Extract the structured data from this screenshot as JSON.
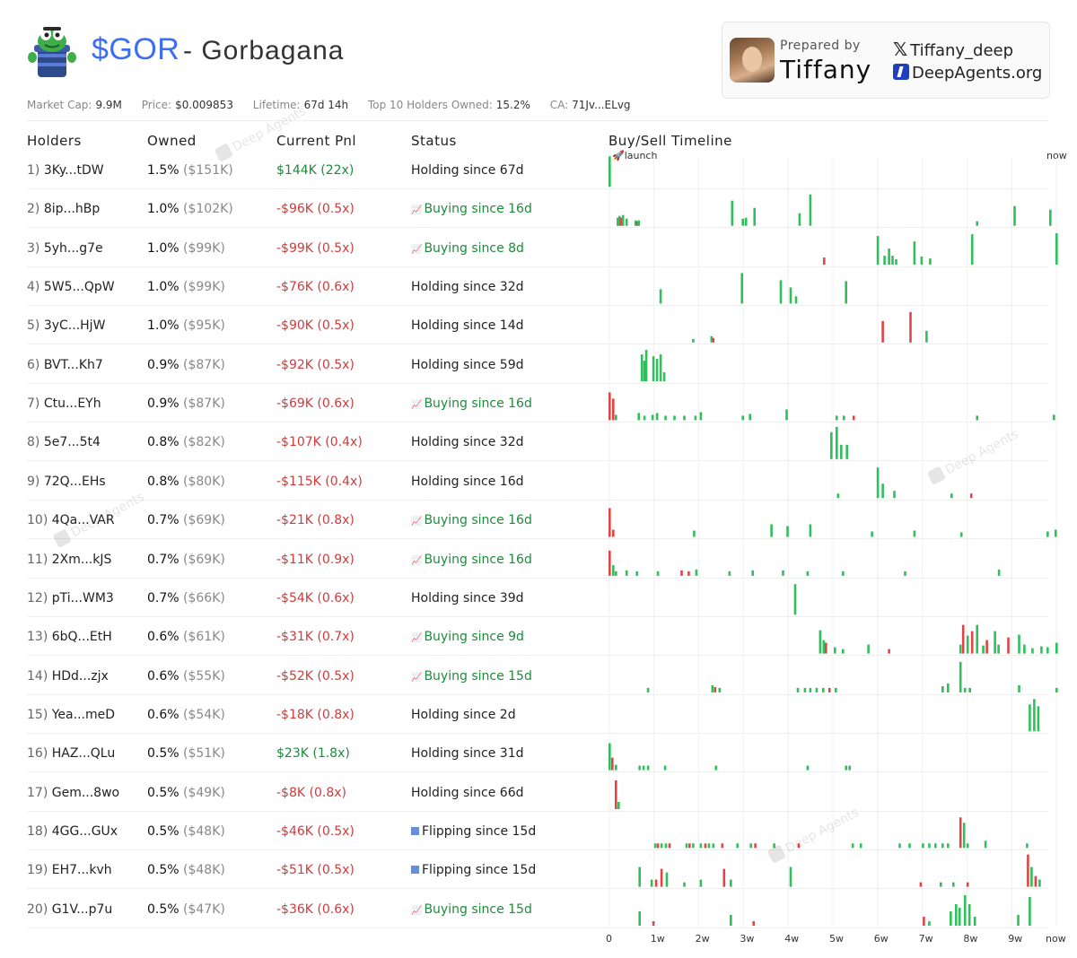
{
  "token": {
    "ticker": "$GOR",
    "name_sep": " - Gorbagana"
  },
  "prepared": {
    "label": "Prepared by",
    "name": "Tiffany",
    "x_handle": "Tiffany_deep",
    "site": "DeepAgents.org"
  },
  "stats": [
    {
      "label": "Market Cap:",
      "value": "9.9M"
    },
    {
      "label": "Price:",
      "value": "$0.009853"
    },
    {
      "label": "Lifetime:",
      "value": "67d 14h"
    },
    {
      "label": "Top 10 Holders Owned:",
      "value": "15.2%"
    },
    {
      "label": "CA:",
      "value": "71Jv...ELvg"
    }
  ],
  "columns": {
    "holders": "Holders",
    "owned": "Owned",
    "pnl": "Current Pnl",
    "status": "Status",
    "timeline": "Buy/Sell Timeline"
  },
  "timeline_axis": {
    "start_label": "🚀launch",
    "end_label": "now",
    "ticks": [
      "0",
      "1w",
      "2w",
      "3w",
      "4w",
      "5w",
      "6w",
      "7w",
      "8w",
      "9w",
      "now"
    ]
  },
  "watermark": "Deep Agents",
  "colors": {
    "buy": "#2fbf5b",
    "sell": "#e04545",
    "accent": "#3b6ef5"
  },
  "holders": [
    {
      "rank": "1)",
      "addr": "3Ky...tDW",
      "pct": "1.5%",
      "usd": "($151K)",
      "pnl": "$144K (22x)",
      "pnl_sign": "pos",
      "status": "Holding since 67d",
      "kind": "hold"
    },
    {
      "rank": "2)",
      "addr": "8ip...hBp",
      "pct": "1.0%",
      "usd": "($102K)",
      "pnl": "-$96K (0.5x)",
      "pnl_sign": "neg",
      "status": "Buying since 16d",
      "kind": "buy"
    },
    {
      "rank": "3)",
      "addr": "5yh...g7e",
      "pct": "1.0%",
      "usd": "($99K)",
      "pnl": "-$99K (0.5x)",
      "pnl_sign": "neg",
      "status": "Buying since 8d",
      "kind": "buy"
    },
    {
      "rank": "4)",
      "addr": "5W5...QpW",
      "pct": "1.0%",
      "usd": "($99K)",
      "pnl": "-$76K (0.6x)",
      "pnl_sign": "neg",
      "status": "Holding since 32d",
      "kind": "hold"
    },
    {
      "rank": "5)",
      "addr": "3yC...HjW",
      "pct": "1.0%",
      "usd": "($95K)",
      "pnl": "-$90K (0.5x)",
      "pnl_sign": "neg",
      "status": "Holding since 14d",
      "kind": "hold"
    },
    {
      "rank": "6)",
      "addr": "BVT...Kh7",
      "pct": "0.9%",
      "usd": "($87K)",
      "pnl": "-$92K (0.5x)",
      "pnl_sign": "neg",
      "status": "Holding since 59d",
      "kind": "hold"
    },
    {
      "rank": "7)",
      "addr": "Ctu...EYh",
      "pct": "0.9%",
      "usd": "($87K)",
      "pnl": "-$69K (0.6x)",
      "pnl_sign": "neg",
      "status": "Buying since 16d",
      "kind": "buy"
    },
    {
      "rank": "8)",
      "addr": "5e7...5t4",
      "pct": "0.8%",
      "usd": "($82K)",
      "pnl": "-$107K (0.4x)",
      "pnl_sign": "neg",
      "status": "Holding since 32d",
      "kind": "hold"
    },
    {
      "rank": "9)",
      "addr": "72Q...EHs",
      "pct": "0.8%",
      "usd": "($80K)",
      "pnl": "-$115K (0.4x)",
      "pnl_sign": "neg",
      "status": "Holding since 16d",
      "kind": "hold"
    },
    {
      "rank": "10)",
      "addr": "4Qa...VAR",
      "pct": "0.7%",
      "usd": "($69K)",
      "pnl": "-$21K (0.8x)",
      "pnl_sign": "neg",
      "status": "Buying since 16d",
      "kind": "buy"
    },
    {
      "rank": "11)",
      "addr": "2Xm...kJS",
      "pct": "0.7%",
      "usd": "($69K)",
      "pnl": "-$11K (0.9x)",
      "pnl_sign": "neg",
      "status": "Buying since 16d",
      "kind": "buy"
    },
    {
      "rank": "12)",
      "addr": "pTi...WM3",
      "pct": "0.7%",
      "usd": "($66K)",
      "pnl": "-$54K (0.6x)",
      "pnl_sign": "neg",
      "status": "Holding since 39d",
      "kind": "hold"
    },
    {
      "rank": "13)",
      "addr": "6bQ...EtH",
      "pct": "0.6%",
      "usd": "($61K)",
      "pnl": "-$31K (0.7x)",
      "pnl_sign": "neg",
      "status": "Buying since 9d",
      "kind": "buy"
    },
    {
      "rank": "14)",
      "addr": "HDd...zjx",
      "pct": "0.6%",
      "usd": "($55K)",
      "pnl": "-$52K (0.5x)",
      "pnl_sign": "neg",
      "status": "Buying since 15d",
      "kind": "buy"
    },
    {
      "rank": "15)",
      "addr": "Yea...meD",
      "pct": "0.6%",
      "usd": "($54K)",
      "pnl": "-$18K (0.8x)",
      "pnl_sign": "neg",
      "status": "Holding since 2d",
      "kind": "hold"
    },
    {
      "rank": "16)",
      "addr": "HAZ...QLu",
      "pct": "0.5%",
      "usd": "($51K)",
      "pnl": "$23K (1.8x)",
      "pnl_sign": "pos",
      "status": "Holding since 31d",
      "kind": "hold"
    },
    {
      "rank": "17)",
      "addr": "Gem...8wo",
      "pct": "0.5%",
      "usd": "($49K)",
      "pnl": "-$8K (0.8x)",
      "pnl_sign": "neg",
      "status": "Holding since 66d",
      "kind": "hold"
    },
    {
      "rank": "18)",
      "addr": "4GG...GUx",
      "pct": "0.5%",
      "usd": "($48K)",
      "pnl": "-$46K (0.5x)",
      "pnl_sign": "neg",
      "status": "Flipping since 15d",
      "kind": "flip"
    },
    {
      "rank": "19)",
      "addr": "EH7...kvh",
      "pct": "0.5%",
      "usd": "($48K)",
      "pnl": "-$51K (0.5x)",
      "pnl_sign": "neg",
      "status": "Flipping since 15d",
      "kind": "flip"
    },
    {
      "rank": "20)",
      "addr": "G1V...p7u",
      "pct": "0.5%",
      "usd": "($47K)",
      "pnl": "-$36K (0.6x)",
      "pnl_sign": "neg",
      "status": "Buying since 15d",
      "kind": "buy"
    }
  ],
  "timeline": [
    [
      [
        0.0,
        1,
        34
      ]
    ],
    [
      [
        1.8,
        1,
        9
      ],
      [
        2.2,
        1,
        11
      ],
      [
        2.5,
        2,
        9
      ],
      [
        3.0,
        1,
        12
      ],
      [
        3.8,
        1,
        8
      ],
      [
        5.8,
        1,
        6
      ],
      [
        6.2,
        2,
        5
      ],
      [
        6.5,
        1,
        6
      ],
      [
        27.4,
        1,
        28
      ],
      [
        29.8,
        1,
        8
      ],
      [
        30.5,
        1,
        9
      ],
      [
        32.4,
        1,
        20
      ],
      [
        42.5,
        1,
        14
      ],
      [
        44.9,
        1,
        35
      ],
      [
        82.2,
        1,
        5
      ],
      [
        90.6,
        1,
        22
      ],
      [
        98.6,
        1,
        18
      ]
    ],
    [
      [
        48.0,
        2,
        8
      ],
      [
        60.0,
        1,
        32
      ],
      [
        61.5,
        1,
        10
      ],
      [
        62.5,
        1,
        18
      ],
      [
        63.3,
        1,
        10
      ],
      [
        64.1,
        1,
        6
      ],
      [
        68.2,
        1,
        26
      ],
      [
        69.8,
        1,
        9
      ],
      [
        71.7,
        1,
        7
      ],
      [
        81.1,
        1,
        34
      ],
      [
        100,
        1,
        35
      ]
    ],
    [
      [
        11.4,
        1,
        16
      ],
      [
        29.6,
        1,
        34
      ],
      [
        38.3,
        1,
        26
      ],
      [
        40.5,
        1,
        18
      ],
      [
        41.7,
        1,
        8
      ],
      [
        52.9,
        1,
        25
      ]
    ],
    [
      [
        18.7,
        1,
        4
      ],
      [
        22.8,
        1,
        7
      ],
      [
        23.2,
        2,
        5
      ],
      [
        61.1,
        2,
        24
      ],
      [
        67.3,
        2,
        34
      ],
      [
        70.9,
        1,
        13
      ]
    ],
    [
      [
        7.2,
        1,
        30
      ],
      [
        7.8,
        1,
        23
      ],
      [
        8.2,
        1,
        35
      ],
      [
        9.8,
        1,
        28
      ],
      [
        10.6,
        1,
        25
      ],
      [
        11.4,
        1,
        30
      ],
      [
        12.2,
        1,
        10
      ]
    ],
    [
      [
        0.0,
        2,
        31
      ],
      [
        0.8,
        2,
        24
      ],
      [
        1.4,
        1,
        6
      ],
      [
        6.5,
        1,
        8
      ],
      [
        7.8,
        1,
        5
      ],
      [
        9.6,
        1,
        6
      ],
      [
        10.6,
        1,
        8
      ],
      [
        12.5,
        1,
        5
      ],
      [
        14.5,
        1,
        5
      ],
      [
        16.7,
        1,
        5
      ],
      [
        19.2,
        1,
        5
      ],
      [
        20.4,
        1,
        9
      ],
      [
        29.8,
        1,
        5
      ],
      [
        31.4,
        1,
        7
      ],
      [
        39.6,
        1,
        12
      ],
      [
        50.8,
        1,
        5
      ],
      [
        52.4,
        1,
        5
      ],
      [
        54.6,
        2,
        5
      ],
      [
        82.2,
        1,
        5
      ],
      [
        99.4,
        1,
        6
      ]
    ],
    [
      [
        49.6,
        1,
        30
      ],
      [
        50.8,
        1,
        36
      ],
      [
        51.8,
        1,
        16
      ],
      [
        53.1,
        1,
        16
      ]
    ],
    [
      [
        51.1,
        1,
        5
      ],
      [
        60.0,
        1,
        34
      ],
      [
        61.1,
        1,
        16
      ],
      [
        63.7,
        1,
        8
      ],
      [
        76.5,
        1,
        5
      ],
      [
        80.9,
        2,
        5
      ]
    ],
    [
      [
        0.0,
        2,
        32
      ],
      [
        0.8,
        2,
        8
      ],
      [
        18.9,
        1,
        7
      ],
      [
        36.2,
        1,
        14
      ],
      [
        39.8,
        1,
        12
      ],
      [
        44.9,
        1,
        14
      ],
      [
        58.7,
        1,
        6
      ],
      [
        68.2,
        1,
        7
      ],
      [
        78.7,
        1,
        5
      ],
      [
        98.0,
        1,
        6
      ],
      [
        99.8,
        1,
        8
      ]
    ],
    [
      [
        0.0,
        2,
        28
      ],
      [
        0.8,
        1,
        12
      ],
      [
        1.4,
        1,
        5
      ],
      [
        3.8,
        1,
        6
      ],
      [
        6.1,
        1,
        5
      ],
      [
        10.8,
        1,
        5
      ],
      [
        16.1,
        2,
        6
      ],
      [
        17.7,
        2,
        5
      ],
      [
        19.4,
        1,
        7
      ],
      [
        26.8,
        1,
        5
      ],
      [
        32.0,
        1,
        6
      ],
      [
        38.8,
        1,
        6
      ],
      [
        44.3,
        1,
        5
      ],
      [
        52.2,
        1,
        5
      ],
      [
        66.1,
        1,
        5
      ],
      [
        87.1,
        1,
        7
      ]
    ],
    [
      [
        41.5,
        1,
        34
      ]
    ],
    [
      [
        47.1,
        1,
        26
      ],
      [
        47.9,
        1,
        15
      ],
      [
        48.4,
        2,
        12
      ],
      [
        50.4,
        1,
        7
      ],
      [
        52.2,
        1,
        5
      ],
      [
        57.9,
        1,
        10
      ],
      [
        62.5,
        2,
        5
      ],
      [
        78.5,
        1,
        10
      ],
      [
        79.1,
        2,
        32
      ],
      [
        80.1,
        1,
        20
      ],
      [
        81.1,
        2,
        25
      ],
      [
        82.2,
        1,
        32
      ],
      [
        83.6,
        1,
        9
      ],
      [
        84.4,
        2,
        15
      ],
      [
        86.2,
        1,
        25
      ],
      [
        87.0,
        1,
        10
      ],
      [
        89.2,
        2,
        18
      ],
      [
        91.6,
        1,
        21
      ],
      [
        92.8,
        1,
        10
      ],
      [
        94.6,
        1,
        6
      ],
      [
        96.6,
        1,
        8
      ],
      [
        98.0,
        1,
        7
      ],
      [
        100,
        1,
        12
      ]
    ],
    [
      [
        8.6,
        1,
        5
      ],
      [
        23.0,
        1,
        8
      ],
      [
        23.6,
        2,
        6
      ],
      [
        24.6,
        1,
        5
      ],
      [
        42.1,
        1,
        5
      ],
      [
        43.7,
        1,
        5
      ],
      [
        44.9,
        1,
        5
      ],
      [
        46.3,
        1,
        5
      ],
      [
        47.8,
        1,
        5
      ],
      [
        49.2,
        2,
        5
      ],
      [
        50.6,
        1,
        5
      ],
      [
        74.5,
        1,
        7
      ],
      [
        75.7,
        1,
        10
      ],
      [
        78.5,
        1,
        34
      ],
      [
        79.5,
        1,
        5
      ],
      [
        80.6,
        1,
        5
      ],
      [
        91.6,
        1,
        8
      ],
      [
        100,
        1,
        5
      ]
    ],
    [
      [
        94.0,
        1,
        30
      ],
      [
        95.0,
        1,
        36
      ],
      [
        95.9,
        1,
        28
      ]
    ],
    [
      [
        0.0,
        1,
        30
      ],
      [
        0.6,
        2,
        14
      ],
      [
        1.4,
        1,
        6
      ],
      [
        6.7,
        1,
        5
      ],
      [
        7.6,
        1,
        5
      ],
      [
        8.6,
        1,
        5
      ],
      [
        12.4,
        1,
        5
      ],
      [
        23.8,
        1,
        5
      ],
      [
        44.3,
        1,
        5
      ],
      [
        52.9,
        1,
        5
      ],
      [
        53.7,
        1,
        5
      ]
    ],
    [
      [
        1.4,
        2,
        32
      ],
      [
        2.0,
        1,
        8
      ]
    ],
    [
      [
        10.2,
        1,
        5
      ],
      [
        10.8,
        2,
        5
      ],
      [
        11.6,
        1,
        5
      ],
      [
        12.6,
        1,
        5
      ],
      [
        13.4,
        2,
        5
      ],
      [
        17.2,
        1,
        5
      ],
      [
        17.9,
        2,
        5
      ],
      [
        18.7,
        1,
        5
      ],
      [
        20.4,
        1,
        5
      ],
      [
        21.4,
        2,
        5
      ],
      [
        22.2,
        1,
        5
      ],
      [
        23.2,
        1,
        5
      ],
      [
        25.2,
        2,
        5
      ],
      [
        28.6,
        1,
        5
      ],
      [
        31.6,
        1,
        5
      ],
      [
        32.6,
        2,
        5
      ],
      [
        36.8,
        1,
        5
      ],
      [
        42.3,
        2,
        5
      ],
      [
        54.4,
        1,
        5
      ],
      [
        56.2,
        1,
        5
      ],
      [
        64.9,
        1,
        5
      ],
      [
        67.1,
        1,
        5
      ],
      [
        70.1,
        1,
        5
      ],
      [
        71.5,
        1,
        5
      ],
      [
        72.9,
        1,
        5
      ],
      [
        74.5,
        1,
        5
      ],
      [
        75.7,
        1,
        5
      ],
      [
        78.5,
        2,
        34
      ],
      [
        79.3,
        1,
        28
      ],
      [
        80.1,
        1,
        5
      ],
      [
        84.1,
        1,
        8
      ],
      [
        93.4,
        1,
        5
      ]
    ],
    [
      [
        6.7,
        1,
        22
      ],
      [
        9.4,
        1,
        8
      ],
      [
        10.4,
        2,
        8
      ],
      [
        11.6,
        2,
        20
      ],
      [
        12.8,
        1,
        16
      ],
      [
        16.7,
        1,
        5
      ],
      [
        20.4,
        1,
        8
      ],
      [
        25.6,
        2,
        20
      ],
      [
        27.1,
        1,
        8
      ],
      [
        40.5,
        1,
        22
      ],
      [
        69.6,
        2,
        5
      ],
      [
        74.1,
        1,
        5
      ],
      [
        76.9,
        1,
        5
      ],
      [
        80.1,
        2,
        5
      ],
      [
        93.6,
        2,
        36
      ],
      [
        94.4,
        1,
        22
      ],
      [
        95.3,
        2,
        12
      ],
      [
        96.2,
        1,
        8
      ]
    ],
    [
      [
        6.7,
        1,
        16
      ],
      [
        9.8,
        2,
        5
      ],
      [
        27.1,
        1,
        12
      ],
      [
        32.2,
        2,
        5
      ],
      [
        70.3,
        2,
        10
      ],
      [
        71.5,
        1,
        5
      ],
      [
        76.3,
        1,
        16
      ],
      [
        77.5,
        1,
        24
      ],
      [
        78.3,
        1,
        20
      ],
      [
        79.5,
        1,
        34
      ],
      [
        80.5,
        1,
        24
      ],
      [
        81.7,
        1,
        10
      ],
      [
        91.4,
        1,
        12
      ],
      [
        94.0,
        1,
        32
      ]
    ]
  ]
}
